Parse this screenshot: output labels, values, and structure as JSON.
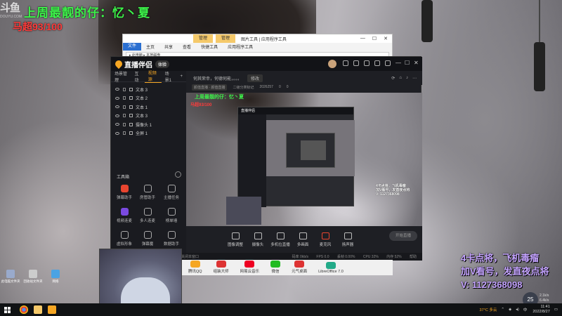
{
  "stream_overlay": {
    "title": "上周最靓的仔：忆丶夏",
    "score": "马超93/100",
    "platform_logo": "斗鱼",
    "platform_sub": "DOUYU.COM"
  },
  "explorer": {
    "tab_manage1": "管理",
    "tab_manage2": "管理",
    "path": "图片工具 | 应用程序工具",
    "ribbon": [
      "文件",
      "主页",
      "共享",
      "查看",
      "快捷工具",
      "应用程序工具"
    ],
    "address": "▸ 此电脑 ▸ 本地磁盘"
  },
  "app": {
    "name": "直播伴侣",
    "version": "体验",
    "side_tabs": [
      "场景管理",
      "互动",
      "视频源",
      "场景1"
    ],
    "scene_items": [
      "文本 3",
      "文本 2",
      "文本 1",
      "文本 3",
      "摄像头 1",
      "全屏 1"
    ],
    "tools_title": "工具箱",
    "tools": [
      {
        "label": "弹幕助手",
        "icon": "danmaku-icon"
      },
      {
        "label": "房管助手",
        "icon": "admin-icon"
      },
      {
        "label": "主播任务",
        "icon": "task-icon"
      },
      {
        "label": "视频连麦",
        "icon": "video-link-icon"
      },
      {
        "label": "多人连麦",
        "icon": "multi-link-icon"
      },
      {
        "label": "榜单墙",
        "icon": "rank-icon"
      },
      {
        "label": "虚拟形象",
        "icon": "avatar-icon"
      },
      {
        "label": "弹幕魔",
        "icon": "magic-icon"
      },
      {
        "label": "数据助手",
        "icon": "data-icon"
      },
      {
        "label": "",
        "icon": "more-icon"
      },
      {
        "label": "",
        "icon": "more-icon"
      },
      {
        "label": "",
        "icon": "more-icon"
      }
    ],
    "live_title": "何其荣幸，何德何能，。。。",
    "modify_btn": "修改",
    "sub_info": [
      "颜值直播 · 颜值直播",
      "二级分类标记",
      "2026257",
      "0",
      "0"
    ],
    "bottom_buttons": [
      "图像调整",
      "摄像头",
      "多机位直播",
      "多画面",
      "麦克风",
      "扬声器"
    ],
    "start_live": "开始直播",
    "status_left": "直播过程中，请勿关闭本窗口",
    "status_right": [
      "码率 0kb/s",
      "FPS 0.0",
      "丢帧 0.00%",
      "CPU 32%",
      "内存 52%",
      "帮助"
    ]
  },
  "preview": {
    "title": "上周最靓的仔：忆丶夏",
    "score": "马超93/100",
    "side_text": [
      "4卡点将，飞机毒瘤",
      "加V看号，发直夜点将",
      "V: 1127368098"
    ],
    "nested_title": "直播伴侣"
  },
  "dock": [
    "腾讯QQ",
    "组装大师",
    "网易云音乐",
    "微信",
    "元气桌面",
    "LibreOffice 7.0"
  ],
  "desktop_icons": [
    "此电脑文件夹",
    "回收站文件夹",
    "网络"
  ],
  "promo": {
    "line1": "4卡点将，飞机毒瘤",
    "line2": "加V看号，发直夜点将",
    "line3": "V: 1127368098"
  },
  "taskbar": {
    "weather": "37°C 多云",
    "time": "11:41",
    "date": "2022/8/27",
    "badge": "25",
    "net_up": "2.1k/s",
    "net_down": "6.4k/s"
  }
}
